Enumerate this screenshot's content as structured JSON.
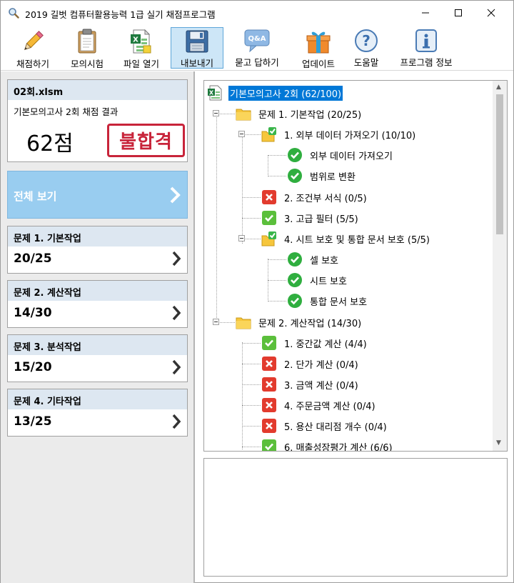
{
  "window": {
    "title": "2019 길벗 컴퓨터활용능력 1급 실기 채점프로그램",
    "controls": {
      "minimize": "minimize",
      "maximize": "maximize",
      "close": "close"
    }
  },
  "toolbar": {
    "buttons": [
      {
        "label": "채점하기",
        "icon": "pencil-icon"
      },
      {
        "label": "모의시험",
        "icon": "clipboard-icon"
      },
      {
        "label": "파일 열기",
        "icon": "excel-file-icon"
      },
      {
        "label": "내보내기",
        "icon": "floppy-disk-icon",
        "active": true
      },
      {
        "label": "묻고 답하기",
        "icon": "qa-bubble-icon"
      },
      {
        "label": "업데이트",
        "icon": "gift-box-icon"
      },
      {
        "label": "도움말",
        "icon": "question-icon"
      },
      {
        "label": "프로그램 정보",
        "icon": "info-icon"
      }
    ]
  },
  "result": {
    "filename": "02회.xlsm",
    "subtitle": "기본모의고사 2회 채점 결과",
    "score": "62점",
    "stamp": "불합격",
    "stamp_color": "#c8243a"
  },
  "view_all": {
    "label": "전체 보기",
    "bg_color": "#99cdf0"
  },
  "problems": [
    {
      "title": "문제 1. 기본작업",
      "score": "20/25"
    },
    {
      "title": "문제 2. 계산작업",
      "score": "14/30"
    },
    {
      "title": "문제 3. 분석작업",
      "score": "15/20"
    },
    {
      "title": "문제 4. 기타작업",
      "score": "13/25"
    }
  ],
  "tree": {
    "root": "기본모의고사 2회 (62/100)",
    "nodes": [
      {
        "label": "문제 1. 기본작업 (20/25)",
        "icon": "folder-icon"
      },
      {
        "label": "1. 외부 데이터 가져오기 (10/10)",
        "icon": "folder-check-icon"
      },
      {
        "label": "외부 데이터 가져오기",
        "icon": "green-check-circle-icon"
      },
      {
        "label": "범위로 변환",
        "icon": "green-check-circle-icon"
      },
      {
        "label": "2. 조건부 서식 (0/5)",
        "icon": "red-x-icon"
      },
      {
        "label": "3. 고급 필터 (5/5)",
        "icon": "green-check-icon"
      },
      {
        "label": "4. 시트 보호 및 통합 문서 보호 (5/5)",
        "icon": "folder-check-icon"
      },
      {
        "label": "셀 보호",
        "icon": "green-check-circle-icon"
      },
      {
        "label": "시트 보호",
        "icon": "green-check-circle-icon"
      },
      {
        "label": "통합 문서 보호",
        "icon": "green-check-circle-icon"
      },
      {
        "label": "문제 2. 계산작업 (14/30)",
        "icon": "folder-icon"
      },
      {
        "label": "1. 중간값 계산 (4/4)",
        "icon": "green-check-icon"
      },
      {
        "label": "2. 단가 계산 (0/4)",
        "icon": "red-x-icon"
      },
      {
        "label": "3. 금액 계산 (0/4)",
        "icon": "red-x-icon"
      },
      {
        "label": "4. 주문금액 계산 (0/4)",
        "icon": "red-x-icon"
      },
      {
        "label": "5. 용산 대리점 개수 (0/4)",
        "icon": "red-x-icon"
      },
      {
        "label": "6. 매출성장평가 계산 (6/6)",
        "icon": "green-check-icon"
      }
    ]
  },
  "colors": {
    "card_header": "#dde7f1",
    "selection": "#0078d7",
    "check_green": "#39b54a",
    "x_red": "#e23b2e"
  }
}
